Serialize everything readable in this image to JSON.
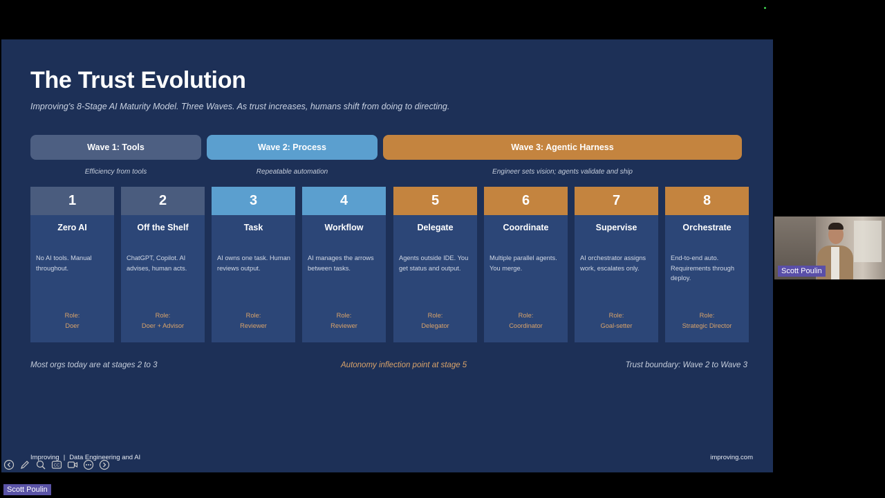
{
  "slide": {
    "title": "The Trust Evolution",
    "subtitle": "Improving's 8-Stage AI Maturity Model. Three Waves. As trust increases, humans shift from doing to directing.",
    "waves": [
      {
        "label": "Wave 1: Tools",
        "tagline": "Efficiency from tools",
        "color": "#4d5f82"
      },
      {
        "label": "Wave 2: Process",
        "tagline": "Repeatable automation",
        "color": "#5b9fcf"
      },
      {
        "label": "Wave 3: Agentic Harness",
        "tagline": "Engineer sets vision; agents validate and ship",
        "color": "#c4843f"
      }
    ],
    "stages": [
      {
        "number": "1",
        "name": "Zero AI",
        "description": "No AI tools. Manual throughout.",
        "role_label": "Role:",
        "role": "Doer"
      },
      {
        "number": "2",
        "name": "Off the Shelf",
        "description": "ChatGPT, Copilot. AI advises, human acts.",
        "role_label": "Role:",
        "role": "Doer + Advisor"
      },
      {
        "number": "3",
        "name": "Task",
        "description": "AI owns one task. Human reviews output.",
        "role_label": "Role:",
        "role": "Reviewer"
      },
      {
        "number": "4",
        "name": "Workflow",
        "description": "AI manages the arrows between tasks.",
        "role_label": "Role:",
        "role": "Reviewer"
      },
      {
        "number": "5",
        "name": "Delegate",
        "description": "Agents outside IDE. You get status and output.",
        "role_label": "Role:",
        "role": "Delegator"
      },
      {
        "number": "6",
        "name": "Coordinate",
        "description": "Multiple parallel agents. You merge.",
        "role_label": "Role:",
        "role": "Coordinator"
      },
      {
        "number": "7",
        "name": "Supervise",
        "description": "AI orchestrator assigns work, escalates only.",
        "role_label": "Role:",
        "role": "Goal-setter"
      },
      {
        "number": "8",
        "name": "Orchestrate",
        "description": "End-to-end auto. Requirements through deploy.",
        "role_label": "Role:",
        "role": "Strategic Director"
      }
    ],
    "notes": {
      "left": "Most orgs today are at stages 2 to 3",
      "center": "Autonomy inflection point at stage 5",
      "right": "Trust boundary: Wave 2 to Wave 3"
    },
    "footer": {
      "brand": "Improving",
      "separator": "|",
      "department": "Data Engineering and AI",
      "site": "improving.com"
    }
  },
  "controls": [
    "back-icon",
    "pen-icon",
    "zoom-icon",
    "captions-icon",
    "video-icon",
    "more-icon",
    "forward-icon"
  ],
  "participant": {
    "name": "Scott Poulin"
  },
  "presenter_badge": "Scott Poulin",
  "colors": {
    "slide_bg": "#1d3057",
    "card_bg": "#2c4677",
    "wave1": "#4d5f82",
    "wave2": "#5b9fcf",
    "wave3": "#c4843f",
    "role_text": "#d9a36a"
  }
}
